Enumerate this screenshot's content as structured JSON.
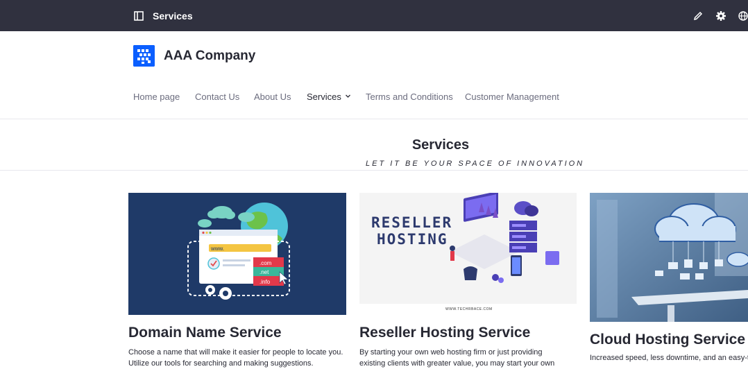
{
  "topbar": {
    "title": "Services",
    "icons": [
      "panel-icon",
      "pencil-icon",
      "gear-icon",
      "globe-icon"
    ]
  },
  "header": {
    "company": "AAA Company",
    "nav": [
      {
        "label": "Home page",
        "active": false
      },
      {
        "label": "Contact Us",
        "active": false
      },
      {
        "label": "About Us",
        "active": false
      },
      {
        "label": "Services",
        "active": true,
        "has_dropdown": true
      },
      {
        "label": "Terms and Conditions",
        "active": false
      },
      {
        "label": "Customer Management",
        "active": false
      }
    ]
  },
  "main": {
    "title": "Services",
    "tagline": "LET IT BE YOUR SPACE OF INNOVATION",
    "cards": [
      {
        "title": "Domain Name Service",
        "text": "Choose a name that will make it easier for people to locate you. Utilize our tools for searching and making suggestions.",
        "image": {
          "url_text": "www.",
          "tlds": [
            ".com",
            ".net",
            ".info"
          ]
        }
      },
      {
        "title": "Reseller Hosting Service",
        "text": "By starting your own web hosting firm or just providing existing clients with greater value, you may start your own",
        "image": {
          "heading_line1": "RESELLER",
          "heading_line2": "HOSTING",
          "credit": "WWW.TECHRBACE.COM"
        }
      },
      {
        "title": "Cloud Hosting Service",
        "text": "Increased speed, less downtime, and an easy-t"
      }
    ]
  },
  "colors": {
    "topbar": "#30313f",
    "brand": "#0b5fff",
    "domain_bg": "#1f3a68",
    "text": "#272833",
    "muted": "#6b6c7e"
  }
}
